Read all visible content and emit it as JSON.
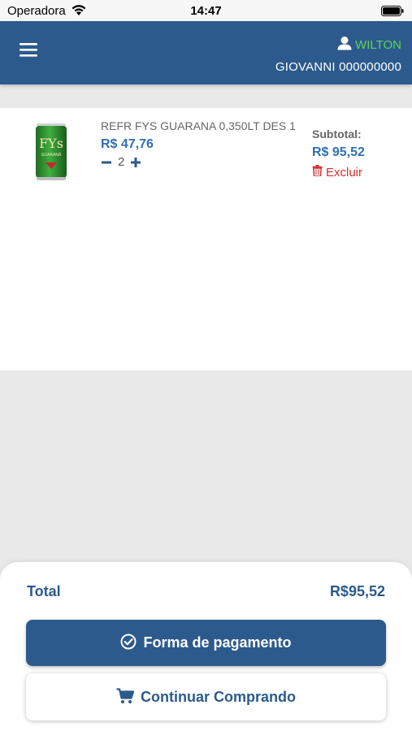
{
  "status_bar": {
    "carrier": "Operadora",
    "time": "14:47",
    "wifi_icon": "wifi-icon",
    "battery_icon": "battery-icon"
  },
  "header": {
    "menu_icon": "hamburger-menu-icon",
    "user_icon": "user-icon",
    "user_name": "WILTON",
    "user_detail": "GIOVANNI 000000000"
  },
  "cart": {
    "items": [
      {
        "name": "REFR FYS GUARANA 0,350LT DES 1",
        "price": "R$ 47,76",
        "quantity": "2",
        "subtotal_label": "Subtotal:",
        "subtotal": "R$ 95,52",
        "remove_label": "Excluir",
        "image_text": "FYs",
        "image_subtext": "GUARANÁ"
      }
    ]
  },
  "footer": {
    "total_label": "Total",
    "total_value": "R$95,52",
    "payment_button": "Forma de pagamento",
    "continue_button": "Continuar Comprando"
  },
  "colors": {
    "primary": "#2c5a8c",
    "price": "#2f6fb2",
    "user_name": "#5fd35a",
    "danger": "#d32f2f"
  }
}
